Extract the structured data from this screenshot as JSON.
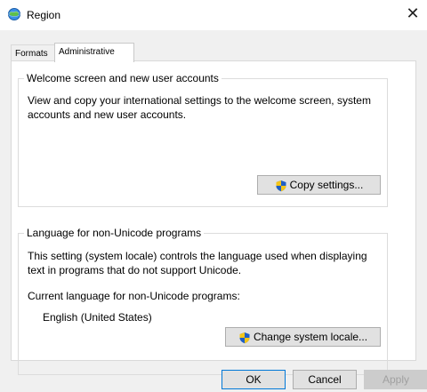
{
  "window": {
    "title": "Region",
    "close_glyph": "✕",
    "icon": "globe-icon"
  },
  "tabs": [
    {
      "label": "Formats",
      "active": false
    },
    {
      "label": "Administrative",
      "active": true
    }
  ],
  "welcome_group": {
    "title": "Welcome screen and new user accounts",
    "description": "View and copy your international settings to the welcome screen, system accounts and new user accounts.",
    "button_label": "Copy settings..."
  },
  "unicode_group": {
    "title": "Language for non-Unicode programs",
    "description": "This setting (system locale) controls the language used when displaying text in programs that do not support Unicode.",
    "current_label": "Current language for non-Unicode programs:",
    "current_value": "English (United States)",
    "button_label": "Change system locale..."
  },
  "footer": {
    "ok": "OK",
    "cancel": "Cancel",
    "apply": "Apply"
  },
  "colors": {
    "accent": "#0078d7",
    "shield_blue": "#1f5fc6",
    "shield_yellow": "#f5c518"
  }
}
